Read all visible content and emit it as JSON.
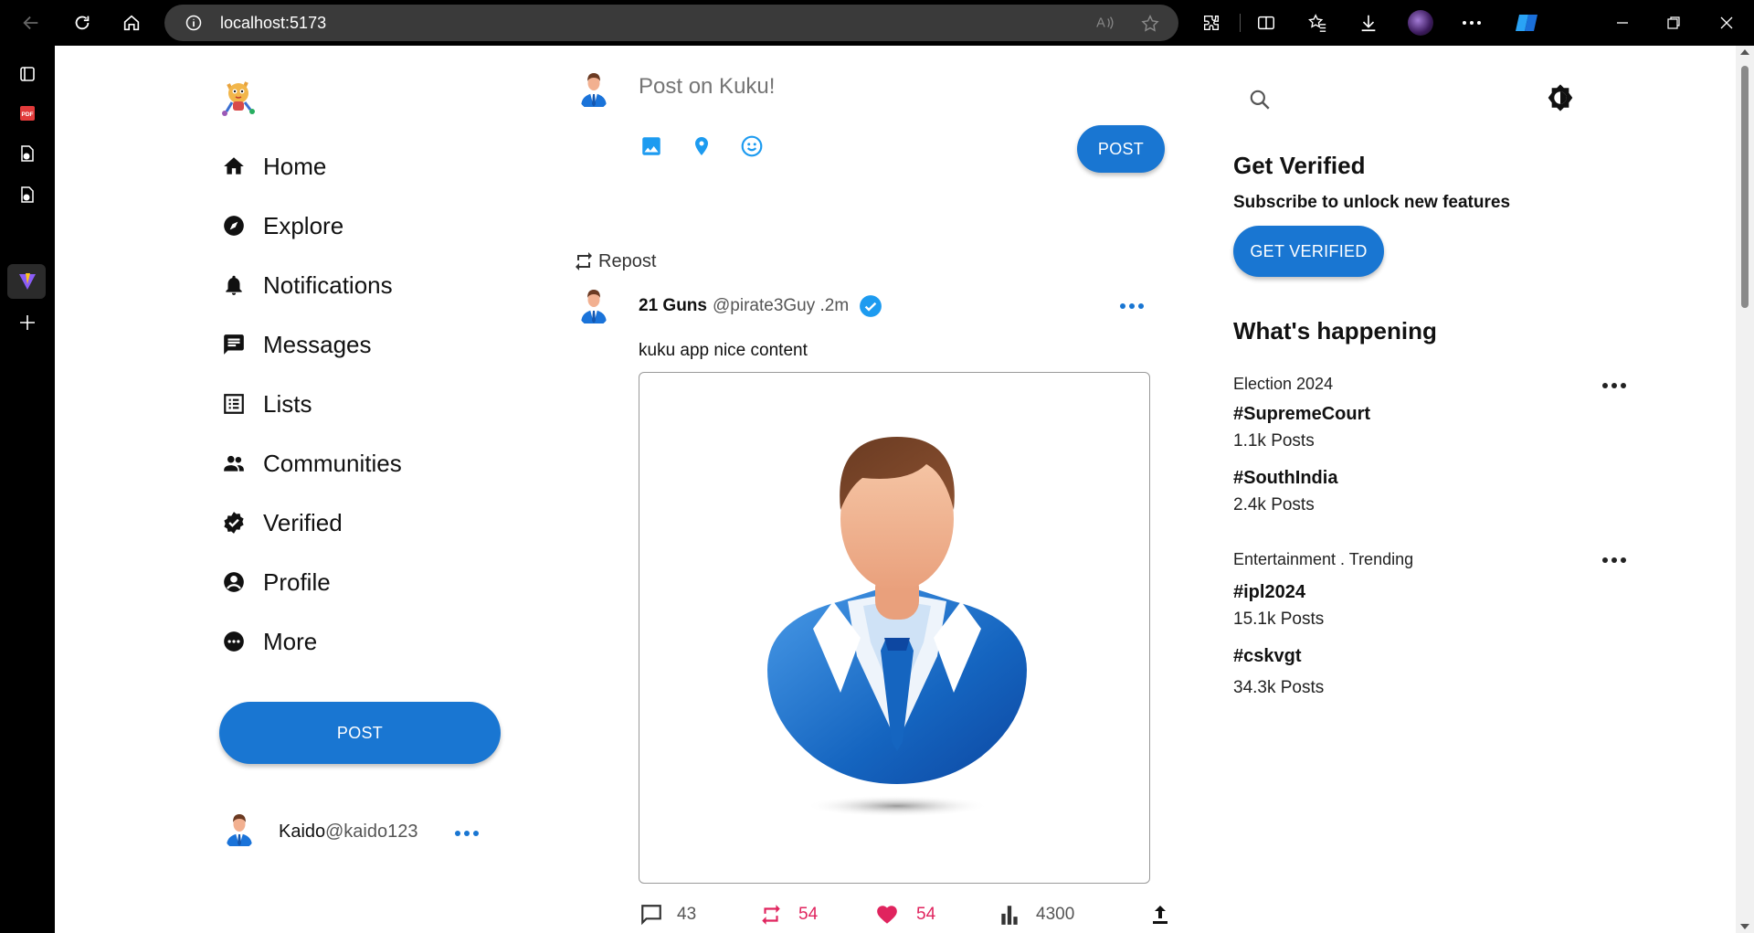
{
  "browser": {
    "url": "localhost:5173"
  },
  "sidebar": {
    "items": [
      {
        "label": "Home",
        "icon": "home-icon"
      },
      {
        "label": "Explore",
        "icon": "explore-icon"
      },
      {
        "label": "Notifications",
        "icon": "bell-icon"
      },
      {
        "label": "Messages",
        "icon": "message-icon"
      },
      {
        "label": "Lists",
        "icon": "list-icon"
      },
      {
        "label": "Communities",
        "icon": "people-icon"
      },
      {
        "label": "Verified",
        "icon": "verified-icon"
      },
      {
        "label": "Profile",
        "icon": "account-icon"
      },
      {
        "label": "More",
        "icon": "more-icon"
      }
    ],
    "post_button": "POST",
    "user": {
      "name": "Kaido",
      "handle": "@kaido123"
    }
  },
  "composer": {
    "placeholder": "Post on Kuku!",
    "post_button": "POST"
  },
  "post": {
    "repost_label": "Repost",
    "author": "21 Guns",
    "handle_time": "@pirate3Guy .2m",
    "text": "kuku app nice content",
    "stats": {
      "comments": "43",
      "reposts": "54",
      "likes": "54",
      "views": "4300"
    }
  },
  "right": {
    "verified_title": "Get Verified",
    "verified_subtitle": "Subscribe to unlock new features",
    "verified_button": "GET VERIFIED",
    "happening_title": "What's happening",
    "sections": [
      {
        "category": "Election 2024",
        "trends": [
          {
            "tag": "#SupremeCourt",
            "count": "1.1k Posts"
          },
          {
            "tag": "#SouthIndia",
            "count": "2.4k Posts"
          }
        ]
      },
      {
        "category": "Entertainment . Trending",
        "trends": [
          {
            "tag": "#ipl2024",
            "count": "15.1k Posts"
          },
          {
            "tag": "#cskvgt",
            "count": "34.3k Posts"
          }
        ]
      }
    ]
  },
  "colors": {
    "primary": "#1976d2",
    "pink": "#e0245e",
    "verified": "#1d9bf0"
  }
}
